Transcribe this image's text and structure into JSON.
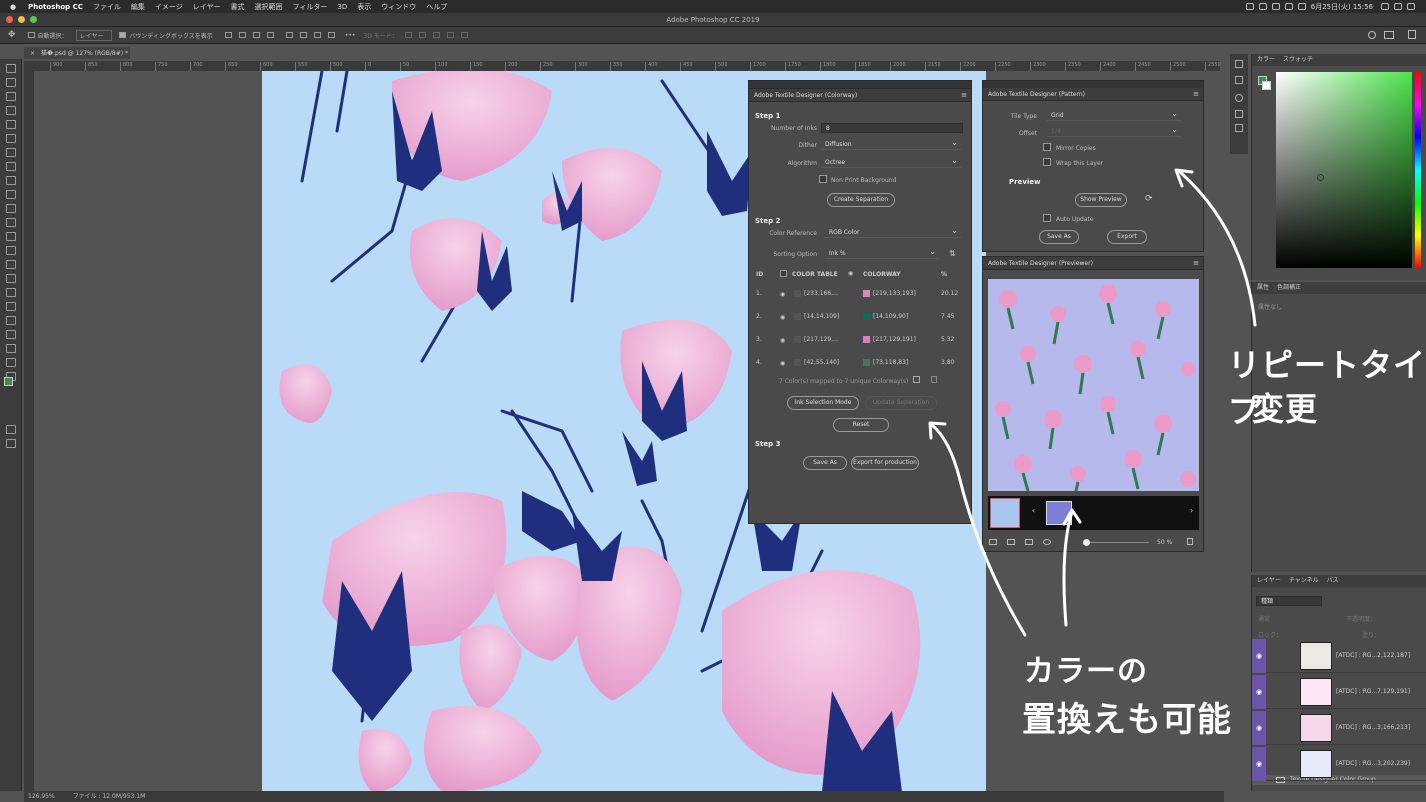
{
  "menubar": {
    "app_name": "Photoshop CC",
    "items": [
      "ファイル",
      "編集",
      "イメージ",
      "レイヤー",
      "書式",
      "選択範囲",
      "フィルター",
      "3D",
      "表示",
      "ウィンドウ",
      "ヘルプ"
    ],
    "clock": "6月25日(火) 15:56"
  },
  "window": {
    "title": "Adobe Photoshop CC 2019"
  },
  "options": {
    "auto_select": "自動選択：",
    "target": "レイヤー",
    "bbox": "バウンディングボックスを表示",
    "mode3d": "3D モード："
  },
  "doc": {
    "tab": "猫�.psd @ 127% (RGB/8#) *"
  },
  "ruler": {
    "ticks": [
      "900",
      "850",
      "800",
      "750",
      "700",
      "650",
      "600",
      "550",
      "500",
      "0",
      "50",
      "100",
      "150",
      "200",
      "250",
      "300",
      "350",
      "400",
      "450",
      "500",
      "1700",
      "1750",
      "1800",
      "1850",
      "2000",
      "2150",
      "2200",
      "2250",
      "2300",
      "2350",
      "2400",
      "2450",
      "2500",
      "2550"
    ]
  },
  "colorway": {
    "title": "Adobe Textile Designer (Colorway)",
    "step1": "Step 1",
    "num_inks_label": "Number of Inks",
    "num_inks": "8",
    "dither_label": "Dither",
    "dither": "Diffusion",
    "algorithm_label": "Algorithm",
    "algorithm": "Octree",
    "nonprint": "Non Print Background",
    "create_sep": "Create Separation",
    "step2": "Step 2",
    "color_ref_label": "Color Reference",
    "color_ref": "RGB Color",
    "sort_label": "Sorting Option",
    "sort": "Ink %",
    "headers": {
      "id": "ID",
      "table": "COLOR TABLE",
      "colorway": "COLORWAY",
      "pct": "%"
    },
    "rows": [
      {
        "id": "1.",
        "src": "[233,166,...",
        "dst": "[219,133,193]",
        "pct": "20.12",
        "sw": "#db85c1"
      },
      {
        "id": "2.",
        "src": "[14,14,109]",
        "dst": "[14,109,90]",
        "pct": "7.45",
        "sw": "#0e6d5a"
      },
      {
        "id": "3.",
        "src": "[217,129,...",
        "dst": "[217,129,191]",
        "pct": "5.32",
        "sw": "#d981bf"
      },
      {
        "id": "4.",
        "src": "[42,55,140]",
        "dst": "[73,118,83]",
        "pct": "3.80",
        "sw": "#497653"
      }
    ],
    "mapped": "7 Color(s) mapped to 7 unique Colorway(s)",
    "ink_mode": "Ink Selection Mode",
    "update_sep": "Update Separation",
    "reset": "Reset",
    "step3": "Step 3",
    "save_as": "Save As",
    "export_prod": "Export for production"
  },
  "pattern": {
    "title": "Adobe Textile Designer (Pattern)",
    "tile_label": "Tile Type",
    "tile": "Grid",
    "offset_label": "Offset",
    "offset": "1/4",
    "mirror": "Mirror Copies",
    "wrap": "Wrap this Layer",
    "preview": "Preview",
    "show_preview": "Show Preview",
    "auto_update": "Auto Update",
    "save_as": "Save As",
    "export": "Export"
  },
  "previewer": {
    "title": "Adobe Textile Designer (Previewer)",
    "zoom": "50 %"
  },
  "color_panel": {
    "tab1": "カラー",
    "tab2": "スウォッチ"
  },
  "props_panel": {
    "tab1": "属性",
    "tab2": "色調補正",
    "note": "属性なし"
  },
  "layers_panel": {
    "tab1": "レイヤー",
    "tab2": "チャンネル",
    "tab3": "パス",
    "kind": "種類",
    "blend": "通常",
    "opacity": "不透明度：",
    "lock": "ロック：",
    "fill": "塗り：",
    "layers": [
      {
        "name": "[ATDC] : RG...2,122,187]"
      },
      {
        "name": "[ATDC] : RG...7,129,191]"
      },
      {
        "name": "[ATDC] : RG...3,166,213]"
      },
      {
        "name": "[ATDC] : RG...3,202,239]"
      }
    ],
    "group": "Textile Designer Color Group"
  },
  "status": {
    "zoom": "126.95%",
    "file": "ファイル : 12.0M/953.1M"
  },
  "annotations": {
    "repeat1": "リピートタイプ",
    "repeat2": "変更",
    "color1": "カラーの",
    "color2": "置換えも可能"
  },
  "colors": {
    "canvas_bg": "#b9dbf7",
    "pink": "#efb4d8",
    "navy": "#1f2f7e",
    "preview_bg": "#b5b9ec"
  }
}
